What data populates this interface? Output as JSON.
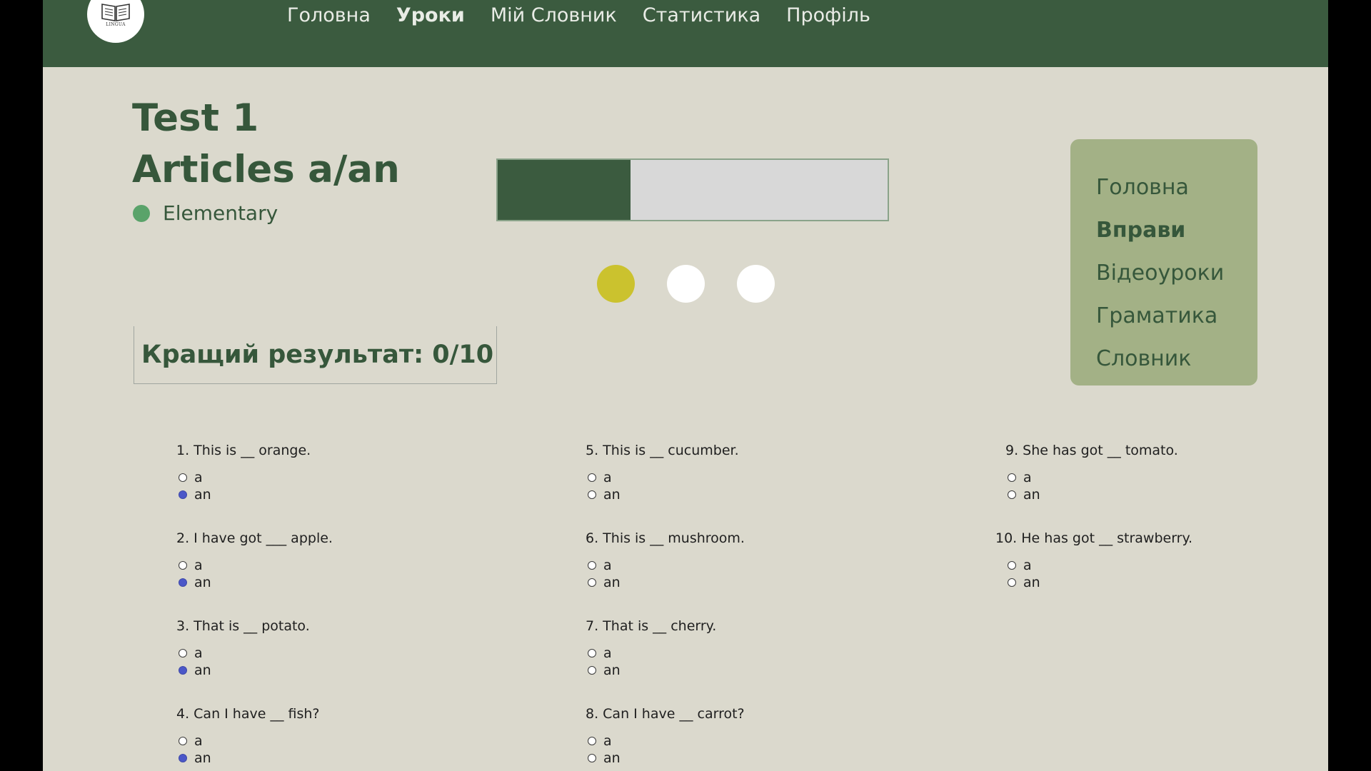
{
  "nav": {
    "logo_text": "LINGUA",
    "links": [
      {
        "label": "Головна"
      },
      {
        "label": "Уроки"
      },
      {
        "label": "Мій Словник"
      },
      {
        "label": "Статистика"
      },
      {
        "label": "Профіль"
      }
    ],
    "active_index": 1
  },
  "header": {
    "title_line1": "Test  1",
    "title_line2": "Articles a/an",
    "level": "Elementary",
    "level_color": "#5aa36a"
  },
  "progress": {
    "fraction": 0.34
  },
  "steps": {
    "count": 3,
    "active_index": 0,
    "active_color": "#cbc22e"
  },
  "best_result": "Кращий результат: 0/10",
  "side_menu": {
    "items": [
      {
        "label": "Головна"
      },
      {
        "label": "Вправи"
      },
      {
        "label": "Відеоуроки"
      },
      {
        "label": "Граматика"
      },
      {
        "label": "Словник"
      }
    ],
    "active_index": 1
  },
  "questions": [
    {
      "text": "1. This is __ orange.",
      "options": [
        "a",
        "an"
      ],
      "selected": 1
    },
    {
      "text": "2. I have got ___ apple.",
      "options": [
        "a",
        "an"
      ],
      "selected": 1
    },
    {
      "text": "3. That is __ potato.",
      "options": [
        "a",
        "an"
      ],
      "selected": 1
    },
    {
      "text": "4. Can I have __ fish?",
      "options": [
        "a",
        "an"
      ],
      "selected": 1
    },
    {
      "text": "5. This is __ cucumber.",
      "options": [
        "a",
        "an"
      ],
      "selected": null
    },
    {
      "text": "6. This is __ mushroom.",
      "options": [
        "a",
        "an"
      ],
      "selected": null
    },
    {
      "text": "7. That is __ cherry.",
      "options": [
        "a",
        "an"
      ],
      "selected": null
    },
    {
      "text": "8. Can I have __ carrot?",
      "options": [
        "a",
        "an"
      ],
      "selected": null
    },
    {
      "text": "9. She has got __ tomato.",
      "options": [
        "a",
        "an"
      ],
      "selected": null
    },
    {
      "text": "10. He has got __ strawberry.",
      "options": [
        "a",
        "an"
      ],
      "selected": null
    }
  ],
  "colors": {
    "brand_green": "#3b5b3f",
    "background": "#dbd9cd",
    "side_menu_bg": "#a3b186",
    "radio_selected": "#4b57c8"
  }
}
